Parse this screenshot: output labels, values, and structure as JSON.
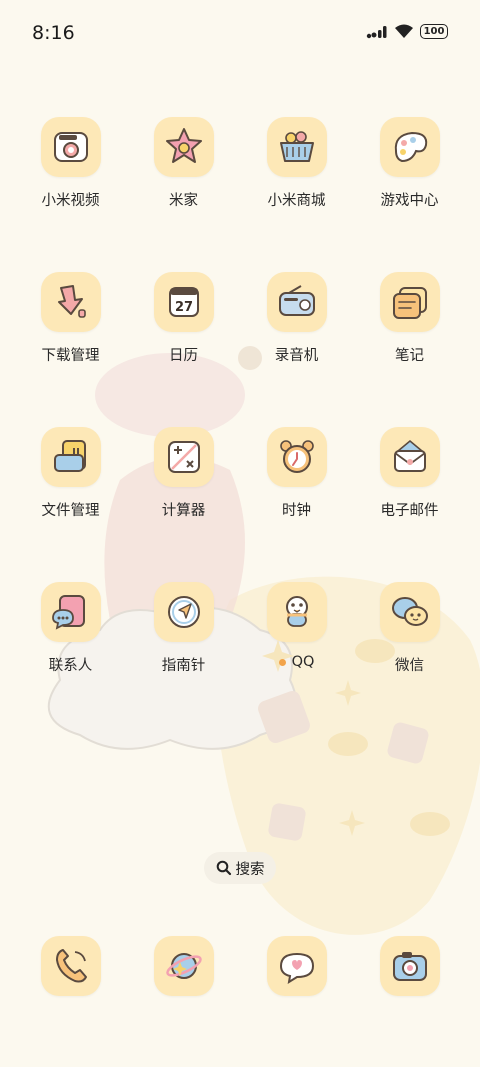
{
  "status_bar": {
    "time": "8:16",
    "battery": "100"
  },
  "apps": [
    {
      "label": "小米视频",
      "icon": "video-icon"
    },
    {
      "label": "米家",
      "icon": "home-icon"
    },
    {
      "label": "小米商城",
      "icon": "shopping-basket-icon"
    },
    {
      "label": "游戏中心",
      "icon": "game-palette-icon"
    },
    {
      "label": "下载管理",
      "icon": "download-icon"
    },
    {
      "label": "日历",
      "icon": "calendar-icon",
      "date": "27"
    },
    {
      "label": "录音机",
      "icon": "radio-recorder-icon"
    },
    {
      "label": "笔记",
      "icon": "notes-icon"
    },
    {
      "label": "文件管理",
      "icon": "folder-icon"
    },
    {
      "label": "计算器",
      "icon": "calculator-icon"
    },
    {
      "label": "时钟",
      "icon": "alarm-clock-icon"
    },
    {
      "label": "电子邮件",
      "icon": "mail-icon"
    },
    {
      "label": "联系人",
      "icon": "contacts-icon"
    },
    {
      "label": "指南针",
      "icon": "compass-icon"
    },
    {
      "label": "QQ",
      "icon": "qq-penguin-icon"
    },
    {
      "label": "微信",
      "icon": "wechat-icon"
    }
  ],
  "search": {
    "label": "搜索"
  },
  "dock": [
    {
      "icon": "phone-icon"
    },
    {
      "icon": "browser-planet-icon"
    },
    {
      "icon": "messages-icon"
    },
    {
      "icon": "camera-icon"
    }
  ],
  "colors": {
    "background": "#fcf9ef",
    "icon_tile": "#fde8b7",
    "notification_dot": "#f2a34a"
  }
}
